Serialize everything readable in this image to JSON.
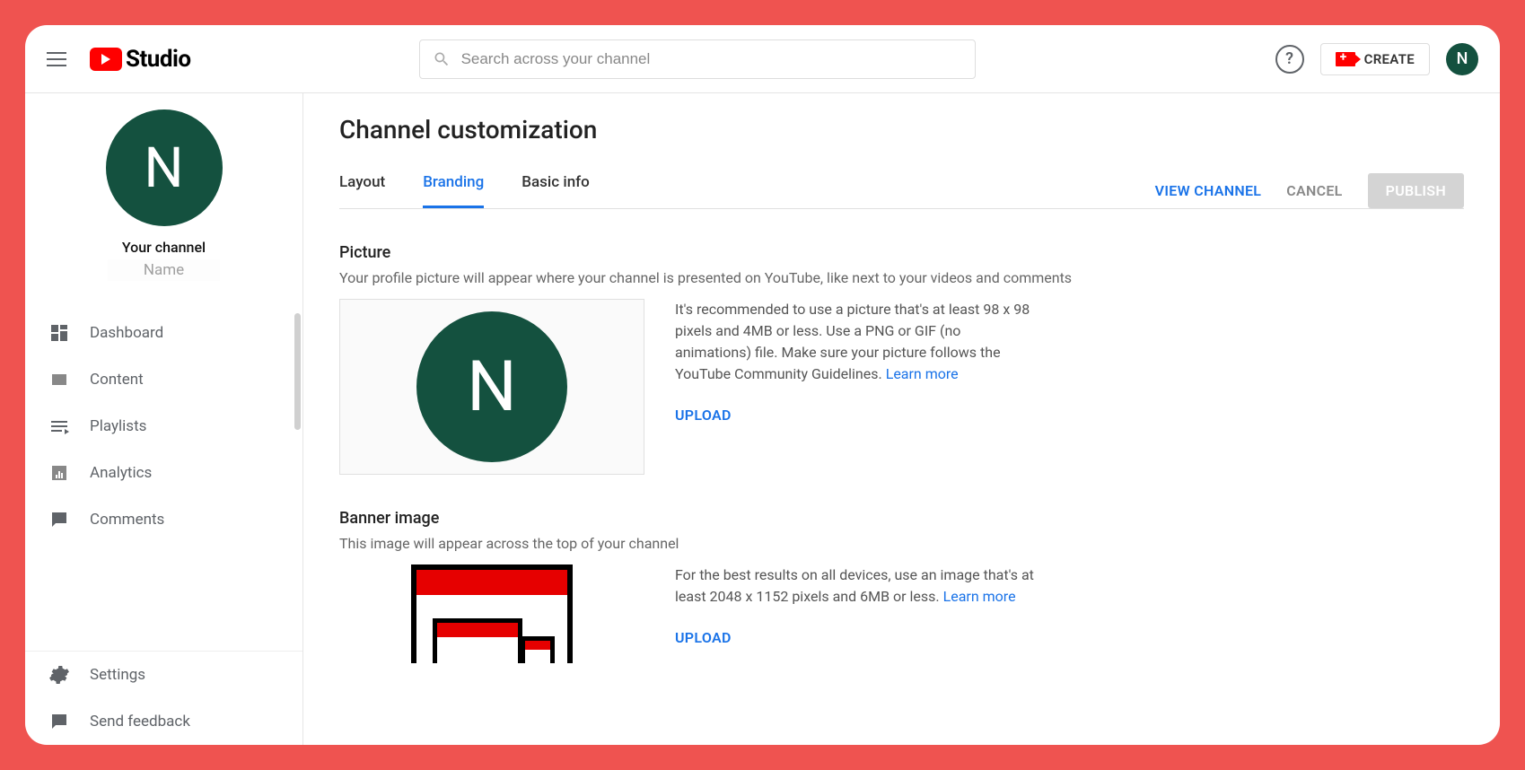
{
  "header": {
    "logo_text": "Studio",
    "search_placeholder": "Search across your channel",
    "create_label": "CREATE",
    "avatar_letter": "N"
  },
  "sidebar": {
    "channel_label": "Your channel",
    "channel_name": "Name",
    "avatar_letter": "N",
    "items": [
      {
        "label": "Dashboard"
      },
      {
        "label": "Content"
      },
      {
        "label": "Playlists"
      },
      {
        "label": "Analytics"
      },
      {
        "label": "Comments"
      }
    ],
    "bottom": [
      {
        "label": "Settings"
      },
      {
        "label": "Send feedback"
      }
    ]
  },
  "main": {
    "page_title": "Channel customization",
    "tabs": [
      {
        "label": "Layout",
        "active": false
      },
      {
        "label": "Branding",
        "active": true
      },
      {
        "label": "Basic info",
        "active": false
      }
    ],
    "actions": {
      "view_channel": "VIEW CHANNEL",
      "cancel": "CANCEL",
      "publish": "PUBLISH"
    },
    "sections": {
      "picture": {
        "title": "Picture",
        "desc": "Your profile picture will appear where your channel is presented on YouTube, like next to your videos and comments",
        "info": "It's recommended to use a picture that's at least 98 x 98 pixels and 4MB or less. Use a PNG or GIF (no animations) file. Make sure your picture follows the YouTube Community Guidelines. ",
        "learn_more": "Learn more",
        "upload": "UPLOAD",
        "avatar_letter": "N"
      },
      "banner": {
        "title": "Banner image",
        "desc": "This image will appear across the top of your channel",
        "info": "For the best results on all devices, use an image that's at least 2048 x 1152 pixels and 6MB or less. ",
        "learn_more": "Learn more",
        "upload": "UPLOAD"
      }
    }
  },
  "colors": {
    "brand_red": "#ff0000",
    "link_blue": "#1a73e8",
    "avatar_green": "#14513f",
    "outer_bg": "#ef5350"
  }
}
